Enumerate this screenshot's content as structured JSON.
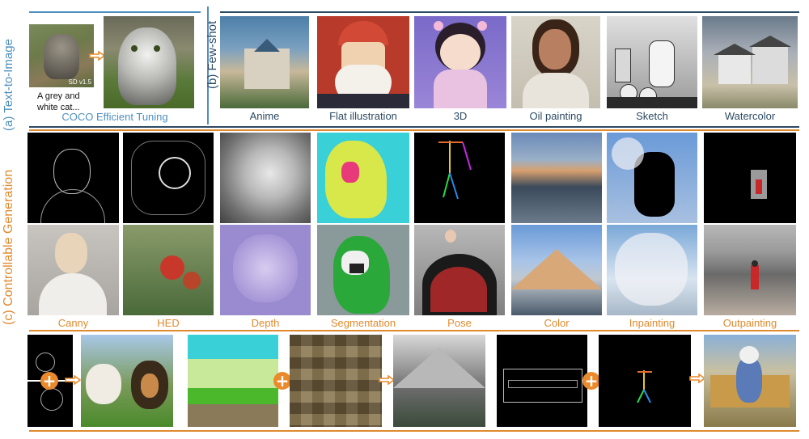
{
  "colors": {
    "blue": "#4f8fbd",
    "dark_blue": "#2d4a63",
    "orange": "#e08a2e"
  },
  "section_a": {
    "label": "(a) Text-to-Image",
    "sd_tag": "SD v1.5",
    "prompt_line1": "A grey and",
    "prompt_line2": "white cat...",
    "caption": "COCO Efficient Tuning"
  },
  "section_b": {
    "label": "(b) Few-shot",
    "styles": [
      "Anime",
      "Flat illustration",
      "3D",
      "Oil painting",
      "Sketch",
      "Watercolor"
    ]
  },
  "section_c": {
    "label": "(c) Controllable Generation",
    "conditions": [
      "Canny",
      "HED",
      "Depth",
      "Segmentation",
      "Pose",
      "Color",
      "Inpainting",
      "Outpainting"
    ]
  }
}
